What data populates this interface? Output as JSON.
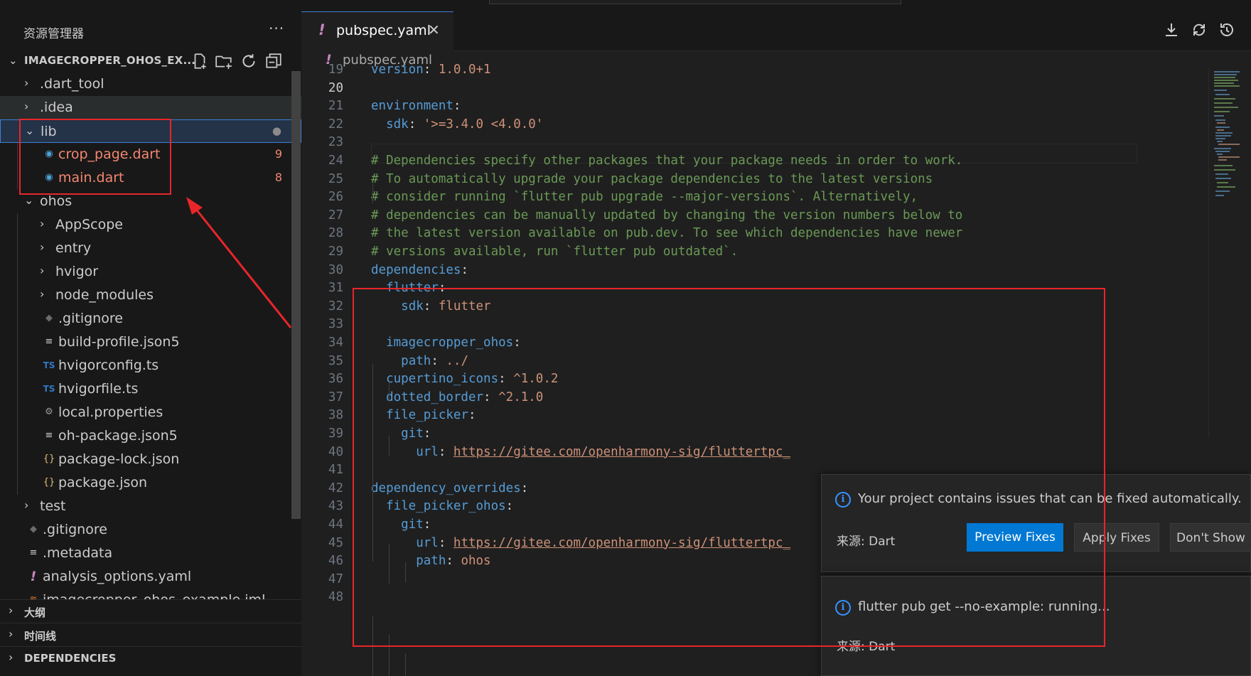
{
  "explorer": {
    "title": "资源管理器",
    "more": "···",
    "project": "IMAGECROPPER_OHOS_EX...",
    "actions": [
      "new-file-icon",
      "new-folder-icon",
      "refresh-icon",
      "collapse-all-icon"
    ],
    "tree": [
      {
        "label": ".dart_tool",
        "chevron": "›",
        "icon": ""
      },
      {
        "label": ".idea",
        "chevron": "›",
        "icon": ""
      },
      {
        "label": "lib",
        "chevron": "⌄",
        "icon": "",
        "badge": "●"
      },
      {
        "label": "crop_page.dart",
        "chevron": "",
        "icon": "◉",
        "badge": "9"
      },
      {
        "label": "main.dart",
        "chevron": "",
        "icon": "◉",
        "badge": "8"
      },
      {
        "label": "ohos",
        "chevron": "⌄",
        "icon": ""
      },
      {
        "label": "AppScope",
        "chevron": "›",
        "icon": ""
      },
      {
        "label": "entry",
        "chevron": "›",
        "icon": ""
      },
      {
        "label": "hvigor",
        "chevron": "›",
        "icon": ""
      },
      {
        "label": "node_modules",
        "chevron": "›",
        "icon": ""
      },
      {
        "label": ".gitignore",
        "chevron": "",
        "icon": "◆"
      },
      {
        "label": "build-profile.json5",
        "chevron": "",
        "icon": "≡"
      },
      {
        "label": "hvigorconfig.ts",
        "chevron": "",
        "icon": "TS"
      },
      {
        "label": "hvigorfile.ts",
        "chevron": "",
        "icon": "TS"
      },
      {
        "label": "local.properties",
        "chevron": "",
        "icon": "⚙"
      },
      {
        "label": "oh-package.json5",
        "chevron": "",
        "icon": "≡"
      },
      {
        "label": "package-lock.json",
        "chevron": "",
        "icon": "{}"
      },
      {
        "label": "package.json",
        "chevron": "",
        "icon": "{}"
      },
      {
        "label": "test",
        "chevron": "›",
        "icon": ""
      },
      {
        "label": ".gitignore",
        "chevron": "",
        "icon": "◆"
      },
      {
        "label": ".metadata",
        "chevron": "",
        "icon": "≡"
      },
      {
        "label": "analysis_options.yaml",
        "chevron": "",
        "icon": "!"
      },
      {
        "label": "imagecropper_ohos_example.iml",
        "chevron": "",
        "icon": "≋"
      }
    ],
    "sections": [
      {
        "label": "大纲"
      },
      {
        "label": "时间线"
      },
      {
        "label": "DEPENDENCIES"
      }
    ]
  },
  "editor": {
    "tab": {
      "icon": "!",
      "label": "pubspec.yaml",
      "close": "✕"
    },
    "toolbar": [
      "download-icon",
      "sync-icon",
      "history-icon"
    ],
    "breadcrumb": {
      "icon": "!",
      "label": "pubspec.yaml"
    },
    "lines": [
      {
        "n": "19",
        "tokens": [
          [
            "k",
            "version"
          ],
          [
            "p",
            ": "
          ],
          [
            "s",
            "1.0.0+1"
          ]
        ]
      },
      {
        "n": "20",
        "tokens": []
      },
      {
        "n": "21",
        "tokens": [
          [
            "k",
            "environment"
          ],
          [
            "p",
            ":"
          ]
        ]
      },
      {
        "n": "22",
        "tokens": [
          [
            "p",
            "  "
          ],
          [
            "k",
            "sdk"
          ],
          [
            "p",
            ": "
          ],
          [
            "s",
            "'>=3.4.0 <4.0.0'"
          ]
        ]
      },
      {
        "n": "23",
        "tokens": []
      },
      {
        "n": "24",
        "tokens": [
          [
            "c",
            "# Dependencies specify other packages that your package needs in order to work."
          ]
        ]
      },
      {
        "n": "25",
        "tokens": [
          [
            "c",
            "# To automatically upgrade your package dependencies to the latest versions"
          ]
        ]
      },
      {
        "n": "26",
        "tokens": [
          [
            "c",
            "# consider running `flutter pub upgrade --major-versions`. Alternatively,"
          ]
        ]
      },
      {
        "n": "27",
        "tokens": [
          [
            "c",
            "# dependencies can be manually updated by changing the version numbers below to"
          ]
        ]
      },
      {
        "n": "28",
        "tokens": [
          [
            "c",
            "# the latest version available on pub.dev. To see which dependencies have newer"
          ]
        ]
      },
      {
        "n": "29",
        "tokens": [
          [
            "c",
            "# versions available, run `flutter pub outdated`."
          ]
        ]
      },
      {
        "n": "30",
        "tokens": [
          [
            "k",
            "dependencies"
          ],
          [
            "p",
            ":"
          ]
        ]
      },
      {
        "n": "31",
        "tokens": [
          [
            "p",
            "  "
          ],
          [
            "k",
            "flutter"
          ],
          [
            "p",
            ":"
          ]
        ]
      },
      {
        "n": "32",
        "tokens": [
          [
            "p",
            "    "
          ],
          [
            "k",
            "sdk"
          ],
          [
            "p",
            ": "
          ],
          [
            "s",
            "flutter"
          ]
        ]
      },
      {
        "n": "33",
        "tokens": []
      },
      {
        "n": "34",
        "tokens": [
          [
            "p",
            "  "
          ],
          [
            "k",
            "imagecropper_ohos"
          ],
          [
            "p",
            ":"
          ]
        ]
      },
      {
        "n": "35",
        "tokens": [
          [
            "p",
            "    "
          ],
          [
            "k",
            "path"
          ],
          [
            "p",
            ": "
          ],
          [
            "s",
            "../"
          ]
        ]
      },
      {
        "n": "36",
        "tokens": [
          [
            "p",
            "  "
          ],
          [
            "k",
            "cupertino_icons"
          ],
          [
            "p",
            ": "
          ],
          [
            "s",
            "^1.0.2"
          ]
        ]
      },
      {
        "n": "37",
        "tokens": [
          [
            "p",
            "  "
          ],
          [
            "k",
            "dotted_border"
          ],
          [
            "p",
            ": "
          ],
          [
            "s",
            "^2.1.0"
          ]
        ]
      },
      {
        "n": "38",
        "tokens": [
          [
            "p",
            "  "
          ],
          [
            "k",
            "file_picker"
          ],
          [
            "p",
            ":"
          ]
        ]
      },
      {
        "n": "39",
        "tokens": [
          [
            "p",
            "    "
          ],
          [
            "k",
            "git"
          ],
          [
            "p",
            ":"
          ]
        ]
      },
      {
        "n": "40",
        "tokens": [
          [
            "p",
            "      "
          ],
          [
            "k",
            "url"
          ],
          [
            "p",
            ": "
          ],
          [
            "u",
            "https://gitee.com/openharmony-sig/fluttertpc_"
          ]
        ]
      },
      {
        "n": "41",
        "tokens": []
      },
      {
        "n": "42",
        "tokens": [
          [
            "k",
            "dependency_overrides"
          ],
          [
            "p",
            ":"
          ]
        ]
      },
      {
        "n": "43",
        "tokens": [
          [
            "p",
            "  "
          ],
          [
            "k",
            "file_picker_ohos"
          ],
          [
            "p",
            ":"
          ]
        ]
      },
      {
        "n": "44",
        "tokens": [
          [
            "p",
            "    "
          ],
          [
            "k",
            "git"
          ],
          [
            "p",
            ":"
          ]
        ]
      },
      {
        "n": "45",
        "tokens": [
          [
            "p",
            "      "
          ],
          [
            "k",
            "url"
          ],
          [
            "p",
            ": "
          ],
          [
            "u",
            "https://gitee.com/openharmony-sig/fluttertpc_"
          ]
        ]
      },
      {
        "n": "46",
        "tokens": [
          [
            "p",
            "      "
          ],
          [
            "k",
            "path"
          ],
          [
            "p",
            ": "
          ],
          [
            "s",
            "ohos"
          ]
        ]
      },
      {
        "n": "47",
        "tokens": []
      },
      {
        "n": "48",
        "tokens": []
      }
    ]
  },
  "notifications": [
    {
      "message": "Your project contains issues that can be fixed automatically.",
      "source": "来源: Dart",
      "buttons": [
        "Preview Fixes",
        "Apply Fixes",
        "Don't Show"
      ]
    },
    {
      "message": "flutter pub get --no-example: running...",
      "source": "来源: Dart"
    }
  ],
  "colors": {
    "accent": "#0078d4",
    "error": "#f48771",
    "annotation": "#e8262a"
  }
}
